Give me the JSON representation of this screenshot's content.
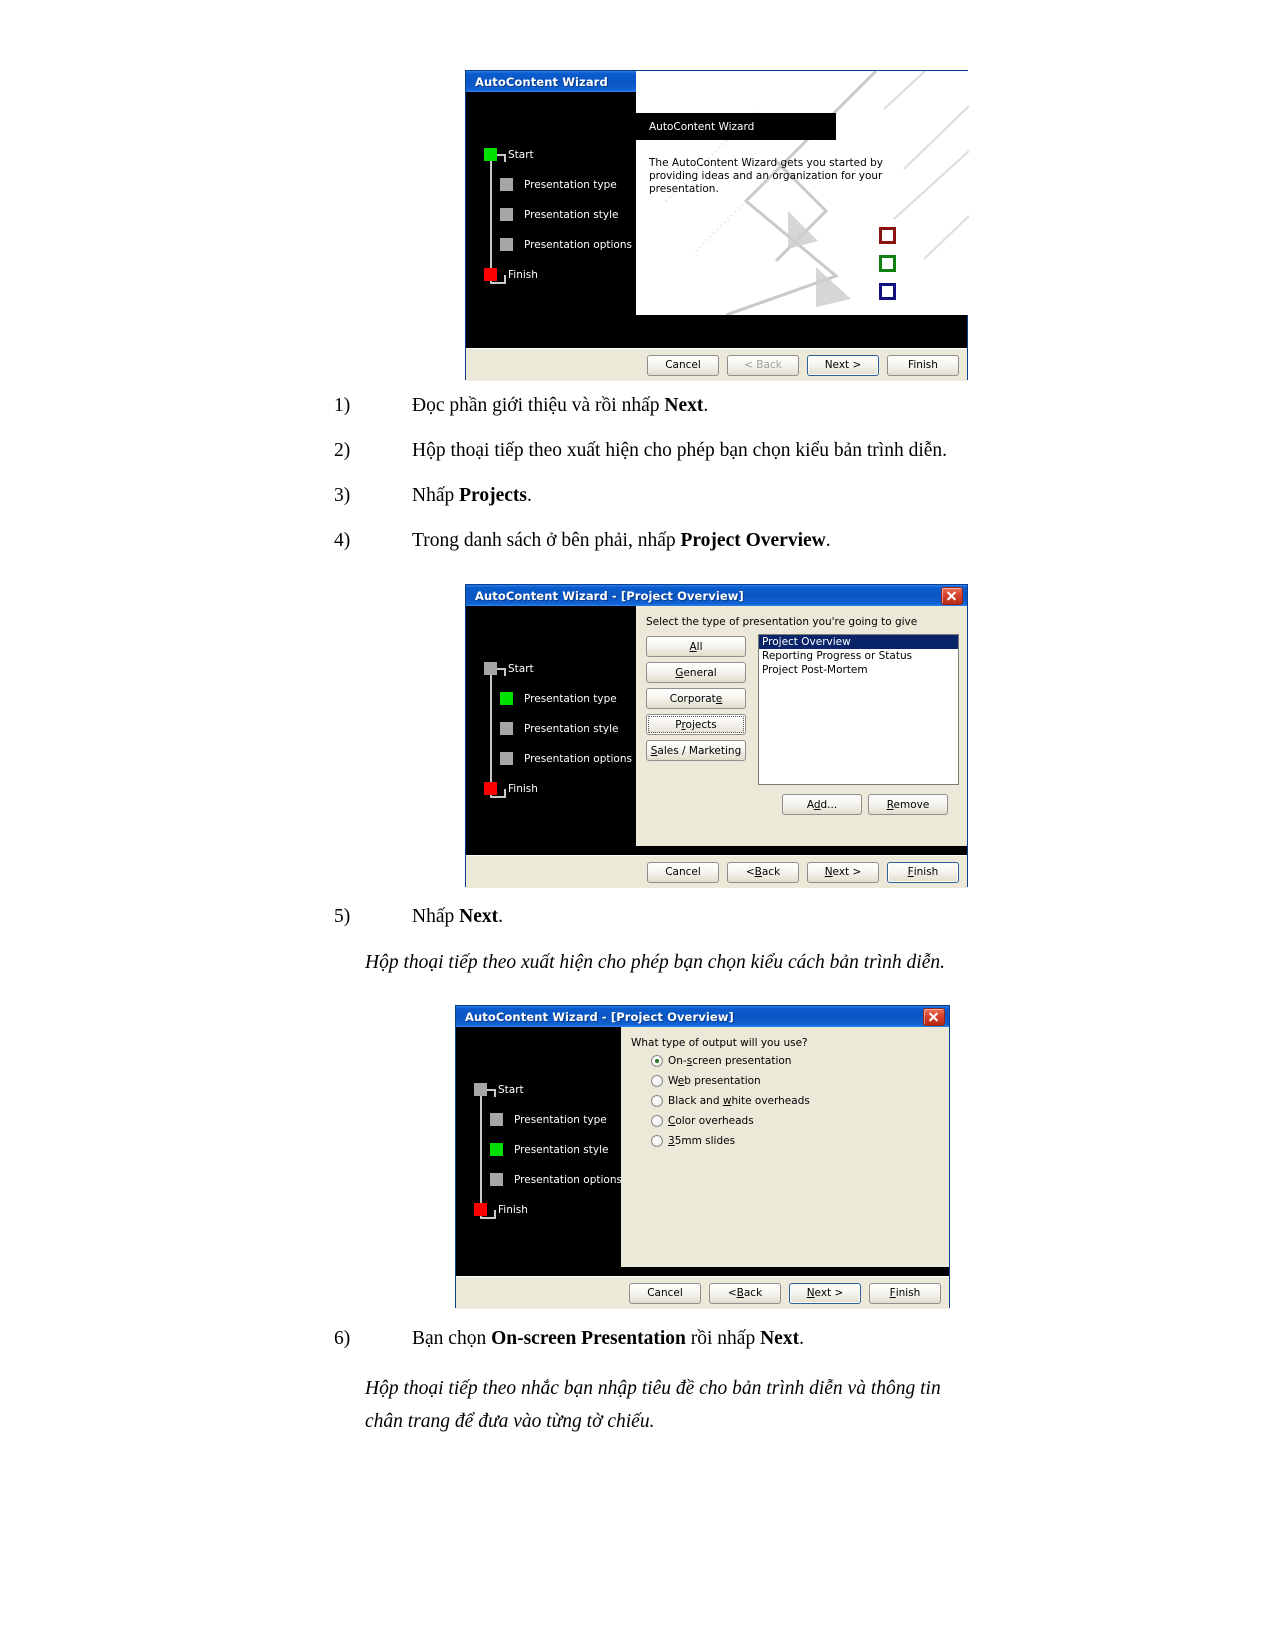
{
  "document": {
    "steps": [
      {
        "num": "1)",
        "pre": "Đọc phần giới thiệu và rồi nhấp ",
        "bold": "Next",
        "post": "."
      },
      {
        "num": "2)",
        "pre": "Hộp thoại tiếp theo xuất hiện cho phép bạn chọn kiểu bản trình diễn.",
        "bold": "",
        "post": ""
      },
      {
        "num": "3)",
        "pre": "Nhấp ",
        "bold": "Projects",
        "post": "."
      },
      {
        "num": "4)",
        "pre": "Trong danh sách ở bên phải, nhấp ",
        "bold": "Project Overview",
        "post": "."
      },
      {
        "num": "5)",
        "pre": "Nhấp ",
        "bold": "Next",
        "post": "."
      },
      {
        "num": "6)",
        "pre": "Bạn chọn ",
        "bold": "On-screen Presentation",
        "post": " rồi nhấp ",
        "bold2": "Next",
        "post2": "."
      }
    ],
    "note_after_5": "Hộp thoại tiếp theo xuất hiện cho phép bạn chọn kiểu cách bản trình diễn.",
    "note_after_6_line1": "Hộp thoại tiếp theo nhắc bạn nhập tiêu đề cho bản trình diễn và thông tin",
    "note_after_6_line2": "chân trang để đưa vào từng tờ chiếu."
  },
  "wizard_steps": [
    "Start",
    "Presentation type",
    "Presentation style",
    "Presentation options",
    "Finish"
  ],
  "footer_buttons": {
    "cancel": "Cancel",
    "back": "< Back",
    "back_plain": "Back",
    "next": "Next >",
    "next_plain": "Next",
    "finish": "Finish"
  },
  "dialog1": {
    "title": "AutoContent Wizard",
    "active_step_index": 0,
    "illustration_title": "AutoContent Wizard",
    "illustration_text": "The AutoContent Wizard gets you started by providing ideas and an organization for your presentation.",
    "swatch_colors": [
      "#8c1212",
      "#108010",
      "#101080"
    ],
    "buttons": {
      "cancel": "Cancel",
      "back": "< Back",
      "next": "Next >",
      "finish": "Finish"
    }
  },
  "dialog2": {
    "title": "AutoContent Wizard - [Project Overview]",
    "active_step_index": 1,
    "prompt": "Select the type of presentation you're going to give",
    "category_buttons": [
      "All",
      "General",
      "Corporate",
      "Projects",
      "Sales / Marketing"
    ],
    "selected_category": "Projects",
    "list_items": [
      "Project Overview",
      "Reporting Progress or Status",
      "Project Post-Mortem"
    ],
    "selected_list_item": "Project Overview",
    "add_button": "Add...",
    "remove_button": "Remove",
    "buttons": {
      "cancel": "Cancel",
      "back": "< Back",
      "next": "Next >",
      "finish": "Finish"
    }
  },
  "dialog3": {
    "title": "AutoContent Wizard - [Project Overview]",
    "active_step_index": 2,
    "question": "What type of output will you use?",
    "options": [
      {
        "label": "On-screen presentation",
        "selected": true
      },
      {
        "label": "Web presentation",
        "selected": false
      },
      {
        "label": "Black and white overheads",
        "selected": false
      },
      {
        "label": "Color overheads",
        "selected": false
      },
      {
        "label": "35mm slides",
        "selected": false
      }
    ],
    "buttons": {
      "cancel": "Cancel",
      "back": "< Back",
      "next": "Next >",
      "finish": "Finish"
    }
  },
  "colors": {
    "titlebar_blue": "#0a55c2",
    "dialog_face": "#ece9d8",
    "step_active": "#00e000",
    "step_finish": "#fc0000",
    "step_inactive": "#a6a6a6",
    "selection_blue": "#0a246a"
  }
}
